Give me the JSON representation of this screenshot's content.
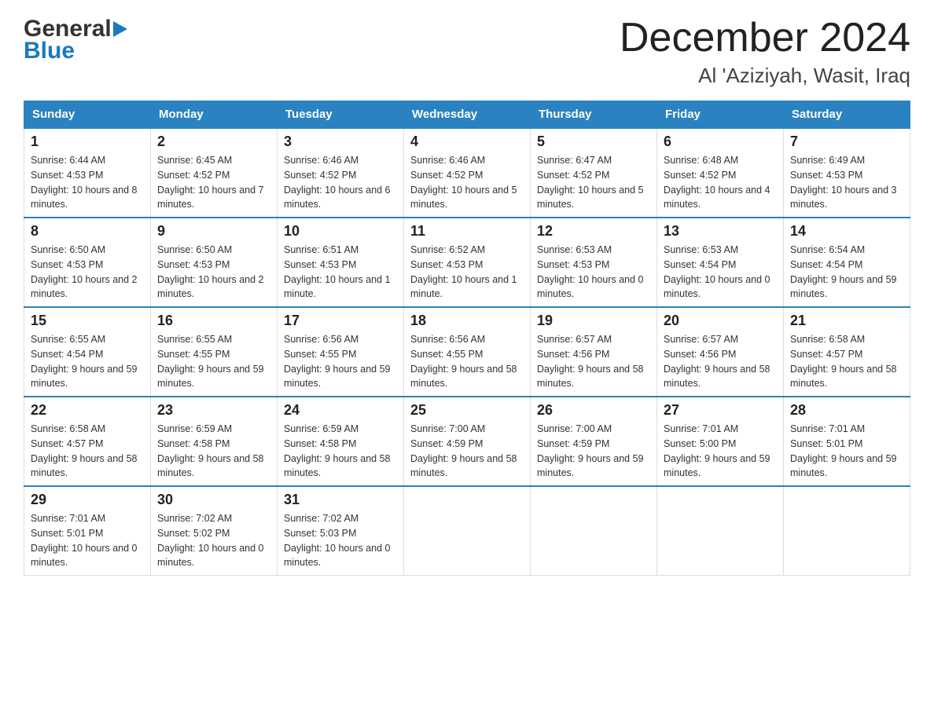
{
  "header": {
    "logo_general": "General",
    "logo_blue": "Blue",
    "month_title": "December 2024",
    "location": "Al 'Aziziyah, Wasit, Iraq"
  },
  "weekdays": [
    "Sunday",
    "Monday",
    "Tuesday",
    "Wednesday",
    "Thursday",
    "Friday",
    "Saturday"
  ],
  "weeks": [
    [
      {
        "day": "1",
        "sunrise": "6:44 AM",
        "sunset": "4:53 PM",
        "daylight": "10 hours and 8 minutes."
      },
      {
        "day": "2",
        "sunrise": "6:45 AM",
        "sunset": "4:52 PM",
        "daylight": "10 hours and 7 minutes."
      },
      {
        "day": "3",
        "sunrise": "6:46 AM",
        "sunset": "4:52 PM",
        "daylight": "10 hours and 6 minutes."
      },
      {
        "day": "4",
        "sunrise": "6:46 AM",
        "sunset": "4:52 PM",
        "daylight": "10 hours and 5 minutes."
      },
      {
        "day": "5",
        "sunrise": "6:47 AM",
        "sunset": "4:52 PM",
        "daylight": "10 hours and 5 minutes."
      },
      {
        "day": "6",
        "sunrise": "6:48 AM",
        "sunset": "4:52 PM",
        "daylight": "10 hours and 4 minutes."
      },
      {
        "day": "7",
        "sunrise": "6:49 AM",
        "sunset": "4:53 PM",
        "daylight": "10 hours and 3 minutes."
      }
    ],
    [
      {
        "day": "8",
        "sunrise": "6:50 AM",
        "sunset": "4:53 PM",
        "daylight": "10 hours and 2 minutes."
      },
      {
        "day": "9",
        "sunrise": "6:50 AM",
        "sunset": "4:53 PM",
        "daylight": "10 hours and 2 minutes."
      },
      {
        "day": "10",
        "sunrise": "6:51 AM",
        "sunset": "4:53 PM",
        "daylight": "10 hours and 1 minute."
      },
      {
        "day": "11",
        "sunrise": "6:52 AM",
        "sunset": "4:53 PM",
        "daylight": "10 hours and 1 minute."
      },
      {
        "day": "12",
        "sunrise": "6:53 AM",
        "sunset": "4:53 PM",
        "daylight": "10 hours and 0 minutes."
      },
      {
        "day": "13",
        "sunrise": "6:53 AM",
        "sunset": "4:54 PM",
        "daylight": "10 hours and 0 minutes."
      },
      {
        "day": "14",
        "sunrise": "6:54 AM",
        "sunset": "4:54 PM",
        "daylight": "9 hours and 59 minutes."
      }
    ],
    [
      {
        "day": "15",
        "sunrise": "6:55 AM",
        "sunset": "4:54 PM",
        "daylight": "9 hours and 59 minutes."
      },
      {
        "day": "16",
        "sunrise": "6:55 AM",
        "sunset": "4:55 PM",
        "daylight": "9 hours and 59 minutes."
      },
      {
        "day": "17",
        "sunrise": "6:56 AM",
        "sunset": "4:55 PM",
        "daylight": "9 hours and 59 minutes."
      },
      {
        "day": "18",
        "sunrise": "6:56 AM",
        "sunset": "4:55 PM",
        "daylight": "9 hours and 58 minutes."
      },
      {
        "day": "19",
        "sunrise": "6:57 AM",
        "sunset": "4:56 PM",
        "daylight": "9 hours and 58 minutes."
      },
      {
        "day": "20",
        "sunrise": "6:57 AM",
        "sunset": "4:56 PM",
        "daylight": "9 hours and 58 minutes."
      },
      {
        "day": "21",
        "sunrise": "6:58 AM",
        "sunset": "4:57 PM",
        "daylight": "9 hours and 58 minutes."
      }
    ],
    [
      {
        "day": "22",
        "sunrise": "6:58 AM",
        "sunset": "4:57 PM",
        "daylight": "9 hours and 58 minutes."
      },
      {
        "day": "23",
        "sunrise": "6:59 AM",
        "sunset": "4:58 PM",
        "daylight": "9 hours and 58 minutes."
      },
      {
        "day": "24",
        "sunrise": "6:59 AM",
        "sunset": "4:58 PM",
        "daylight": "9 hours and 58 minutes."
      },
      {
        "day": "25",
        "sunrise": "7:00 AM",
        "sunset": "4:59 PM",
        "daylight": "9 hours and 58 minutes."
      },
      {
        "day": "26",
        "sunrise": "7:00 AM",
        "sunset": "4:59 PM",
        "daylight": "9 hours and 59 minutes."
      },
      {
        "day": "27",
        "sunrise": "7:01 AM",
        "sunset": "5:00 PM",
        "daylight": "9 hours and 59 minutes."
      },
      {
        "day": "28",
        "sunrise": "7:01 AM",
        "sunset": "5:01 PM",
        "daylight": "9 hours and 59 minutes."
      }
    ],
    [
      {
        "day": "29",
        "sunrise": "7:01 AM",
        "sunset": "5:01 PM",
        "daylight": "10 hours and 0 minutes."
      },
      {
        "day": "30",
        "sunrise": "7:02 AM",
        "sunset": "5:02 PM",
        "daylight": "10 hours and 0 minutes."
      },
      {
        "day": "31",
        "sunrise": "7:02 AM",
        "sunset": "5:03 PM",
        "daylight": "10 hours and 0 minutes."
      },
      null,
      null,
      null,
      null
    ]
  ]
}
